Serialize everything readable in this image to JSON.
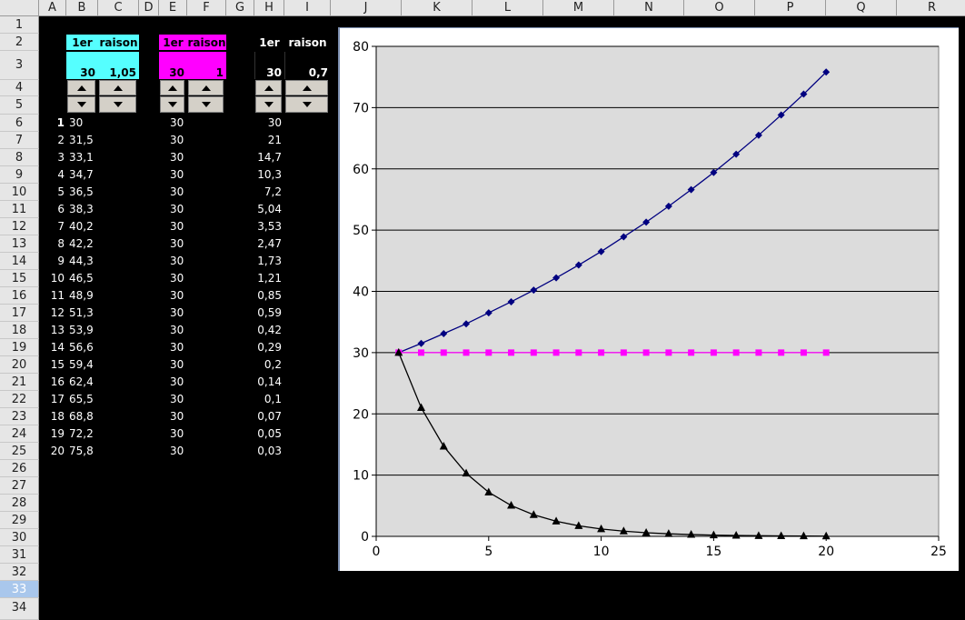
{
  "columns": [
    "A",
    "B",
    "C",
    "D",
    "E",
    "F",
    "G",
    "H",
    "I",
    "J",
    "K",
    "L",
    "M",
    "N",
    "O",
    "P",
    "Q",
    "R"
  ],
  "rows": [
    "1",
    "2",
    "3",
    "4",
    "5",
    "6",
    "7",
    "8",
    "9",
    "10",
    "11",
    "12",
    "13",
    "14",
    "15",
    "16",
    "17",
    "18",
    "19",
    "20",
    "21",
    "22",
    "23",
    "24",
    "25",
    "26",
    "27",
    "28",
    "29",
    "30",
    "31",
    "32",
    "33",
    "34"
  ],
  "selected_row": "33",
  "blocks": [
    {
      "h1": "1er",
      "h2": "raison",
      "v1": "30",
      "v2": "1,05",
      "color": "#55ffff"
    },
    {
      "h1": "1er",
      "h2": "raison",
      "v1": "30",
      "v2": "1",
      "color": "#ff00ff"
    },
    {
      "h1": "1er",
      "h2": "raison",
      "v1": "30",
      "v2": "0,7",
      "color": "#000000"
    }
  ],
  "table": {
    "n": [
      "1",
      "2",
      "3",
      "4",
      "5",
      "6",
      "7",
      "8",
      "9",
      "10",
      "11",
      "12",
      "13",
      "14",
      "15",
      "16",
      "17",
      "18",
      "19",
      "20"
    ],
    "b": [
      "30",
      "31,5",
      "33,1",
      "34,7",
      "36,5",
      "38,3",
      "40,2",
      "42,2",
      "44,3",
      "46,5",
      "48,9",
      "51,3",
      "53,9",
      "56,6",
      "59,4",
      "62,4",
      "65,5",
      "68,8",
      "72,2",
      "75,8"
    ],
    "e": [
      "30",
      "30",
      "30",
      "30",
      "30",
      "30",
      "30",
      "30",
      "30",
      "30",
      "30",
      "30",
      "30",
      "30",
      "30",
      "30",
      "30",
      "30",
      "30",
      "30"
    ],
    "h": [
      "30",
      "21",
      "14,7",
      "10,3",
      "7,2",
      "5,04",
      "3,53",
      "2,47",
      "1,73",
      "1,21",
      "0,85",
      "0,59",
      "0,42",
      "0,29",
      "0,2",
      "0,14",
      "0,1",
      "0,07",
      "0,05",
      "0,03"
    ]
  },
  "chart_data": {
    "type": "line",
    "x": [
      1,
      2,
      3,
      4,
      5,
      6,
      7,
      8,
      9,
      10,
      11,
      12,
      13,
      14,
      15,
      16,
      17,
      18,
      19,
      20
    ],
    "series": [
      {
        "values": [
          30,
          31.5,
          33.1,
          34.7,
          36.5,
          38.3,
          40.2,
          42.2,
          44.3,
          46.5,
          48.9,
          51.3,
          53.9,
          56.6,
          59.4,
          62.4,
          65.5,
          68.8,
          72.2,
          75.8
        ],
        "color": "#000080",
        "marker": "diamond"
      },
      {
        "values": [
          30,
          30,
          30,
          30,
          30,
          30,
          30,
          30,
          30,
          30,
          30,
          30,
          30,
          30,
          30,
          30,
          30,
          30,
          30,
          30
        ],
        "color": "#ff00ff",
        "marker": "square"
      },
      {
        "values": [
          30,
          21,
          14.7,
          10.3,
          7.2,
          5.04,
          3.53,
          2.47,
          1.73,
          1.21,
          0.85,
          0.59,
          0.42,
          0.29,
          0.2,
          0.14,
          0.1,
          0.07,
          0.05,
          0.03
        ],
        "color": "#000000",
        "marker": "triangle"
      }
    ],
    "xlim": [
      0,
      25
    ],
    "ylim": [
      0,
      80
    ],
    "xticks": [
      "0",
      "5",
      "10",
      "15",
      "20",
      "25"
    ],
    "yticks": [
      "0",
      "10",
      "20",
      "30",
      "40",
      "50",
      "60",
      "70",
      "80"
    ],
    "grid": true,
    "plot_background": "#dcdcdc"
  }
}
